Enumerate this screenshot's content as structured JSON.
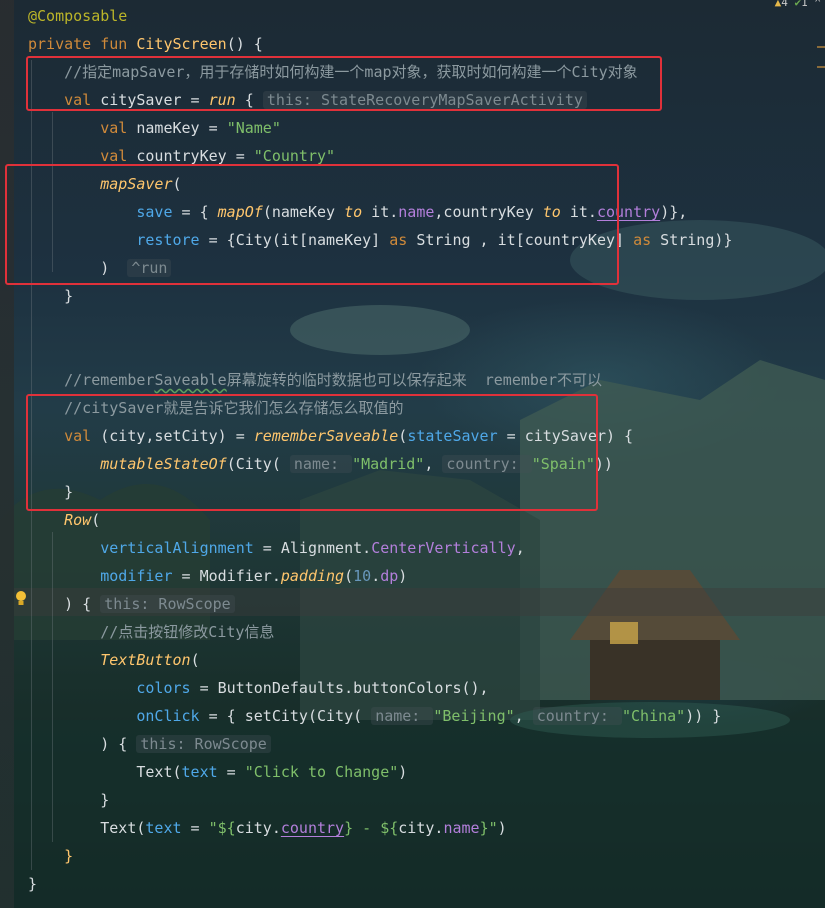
{
  "editor": {
    "top_status": {
      "warnings": "4",
      "weak_warnings": "1"
    },
    "lines": [
      {
        "id": "l1",
        "tokens": [
          {
            "t": "@Composable",
            "c": "ann"
          }
        ]
      },
      {
        "id": "l2",
        "tokens": [
          {
            "t": "private fun ",
            "c": "kw"
          },
          {
            "t": "CityScreen",
            "c": "fn"
          },
          {
            "t": "() {",
            "c": "txt"
          }
        ]
      },
      {
        "id": "l3",
        "tokens": [
          {
            "t": "    //指定mapSaver，用于存储时如何构建一个map对象，获取时如何构建一个City对象",
            "c": "cmt"
          }
        ]
      },
      {
        "id": "l4",
        "tokens": [
          {
            "t": "    val ",
            "c": "kw"
          },
          {
            "t": "citySaver",
            "c": "txt"
          },
          {
            "t": " = ",
            "c": "txt"
          },
          {
            "t": "run",
            "c": "fnit"
          },
          {
            "t": " { ",
            "c": "txt"
          },
          {
            "t": "this: StateRecoveryMapSaverActivity",
            "c": "hint"
          }
        ]
      },
      {
        "id": "l5",
        "tokens": [
          {
            "t": "        val ",
            "c": "kw"
          },
          {
            "t": "nameKey",
            "c": "txt"
          },
          {
            "t": " = ",
            "c": "txt"
          },
          {
            "t": "\"Name\"",
            "c": "str"
          }
        ]
      },
      {
        "id": "l6",
        "tokens": [
          {
            "t": "        val ",
            "c": "kw"
          },
          {
            "t": "countryKey",
            "c": "txt"
          },
          {
            "t": " = ",
            "c": "txt"
          },
          {
            "t": "\"Country\"",
            "c": "str"
          }
        ]
      },
      {
        "id": "l7",
        "tokens": [
          {
            "t": "        mapSaver",
            "c": "fnit"
          },
          {
            "t": "(",
            "c": "txt"
          }
        ]
      },
      {
        "id": "l8",
        "tokens": [
          {
            "t": "            save",
            "c": "prop"
          },
          {
            "t": " = { ",
            "c": "txt"
          },
          {
            "t": "mapOf",
            "c": "fnit"
          },
          {
            "t": "(nameKey ",
            "c": "txt"
          },
          {
            "t": "to",
            "c": "fnit"
          },
          {
            "t": " it.",
            "c": "txt"
          },
          {
            "t": "name",
            "c": "purp"
          },
          {
            "t": ",countryKey ",
            "c": "txt"
          },
          {
            "t": "to",
            "c": "fnit"
          },
          {
            "t": " it.",
            "c": "txt"
          },
          {
            "t": "country",
            "c": "purp",
            "u": "ul"
          },
          {
            "t": ")},",
            "c": "txt"
          }
        ]
      },
      {
        "id": "l9",
        "tokens": [
          {
            "t": "            restore",
            "c": "prop"
          },
          {
            "t": " = {City(",
            "c": "txt"
          },
          {
            "t": "it",
            "c": "txt"
          },
          {
            "t": "[nameKey] ",
            "c": "txt"
          },
          {
            "t": "as",
            "c": "kw"
          },
          {
            "t": " String ,",
            "c": "txt"
          },
          {
            "t": " it",
            "c": "txt"
          },
          {
            "t": "[countryKey] ",
            "c": "txt"
          },
          {
            "t": "as",
            "c": "kw"
          },
          {
            "t": " String)}",
            "c": "txt"
          }
        ]
      },
      {
        "id": "l10",
        "tokens": [
          {
            "t": "        )  ",
            "c": "txt"
          },
          {
            "t": "^run",
            "c": "hint"
          }
        ]
      },
      {
        "id": "l11",
        "tokens": [
          {
            "t": "    }",
            "c": "txt"
          }
        ]
      },
      {
        "id": "l12",
        "tokens": []
      },
      {
        "id": "l13",
        "tokens": []
      },
      {
        "id": "l14",
        "tokens": [
          {
            "t": "    //remember",
            "c": "cmt"
          },
          {
            "t": "Saveable",
            "c": "cmt",
            "u": "wavy"
          },
          {
            "t": "屏幕旋转的临时数据也可以保存起来  remember不可以",
            "c": "cmt"
          }
        ]
      },
      {
        "id": "l15",
        "tokens": [
          {
            "t": "    //citySaver就是告诉它我们怎么存储怎么取值的",
            "c": "cmt"
          }
        ]
      },
      {
        "id": "l16",
        "tokens": [
          {
            "t": "    val ",
            "c": "kw"
          },
          {
            "t": "(city,setCity) = ",
            "c": "txt"
          },
          {
            "t": "rememberSaveable",
            "c": "fnit"
          },
          {
            "t": "(",
            "c": "txt"
          },
          {
            "t": "stateSaver",
            "c": "prop"
          },
          {
            "t": " = citySaver) {",
            "c": "txt"
          }
        ]
      },
      {
        "id": "l17",
        "tokens": [
          {
            "t": "        mutableStateOf",
            "c": "fnit"
          },
          {
            "t": "(City( ",
            "c": "txt"
          },
          {
            "t": "name: ",
            "c": "hint"
          },
          {
            "t": "\"Madrid\"",
            "c": "str"
          },
          {
            "t": ", ",
            "c": "txt"
          },
          {
            "t": "country: ",
            "c": "hint"
          },
          {
            "t": "\"Spain\"",
            "c": "str"
          },
          {
            "t": "))",
            "c": "txt"
          }
        ]
      },
      {
        "id": "l18",
        "tokens": [
          {
            "t": "    }",
            "c": "txt"
          }
        ]
      },
      {
        "id": "l19",
        "tokens": [
          {
            "t": "    Row",
            "c": "fnit"
          },
          {
            "t": "(",
            "c": "txt"
          }
        ]
      },
      {
        "id": "l20",
        "tokens": [
          {
            "t": "        verticalAlignment",
            "c": "prop"
          },
          {
            "t": " = Alignment.",
            "c": "txt"
          },
          {
            "t": "CenterVertically",
            "c": "purp"
          },
          {
            "t": ",",
            "c": "txt"
          }
        ]
      },
      {
        "id": "l21",
        "tokens": [
          {
            "t": "        modifier",
            "c": "prop"
          },
          {
            "t": " = Modifier.",
            "c": "txt"
          },
          {
            "t": "padding",
            "c": "fnit"
          },
          {
            "t": "(",
            "c": "txt"
          },
          {
            "t": "10",
            "c": "num"
          },
          {
            "t": ".",
            "c": "txt"
          },
          {
            "t": "dp",
            "c": "purp"
          },
          {
            "t": ")",
            "c": "txt"
          }
        ]
      },
      {
        "id": "l22",
        "tokens": [
          {
            "t": "    ) { ",
            "c": "txt"
          },
          {
            "t": "this: RowScope",
            "c": "hint"
          }
        ]
      },
      {
        "id": "l23",
        "tokens": [
          {
            "t": "        //点击按钮修改City信息",
            "c": "cmt"
          }
        ]
      },
      {
        "id": "l24",
        "tokens": [
          {
            "t": "        TextButton",
            "c": "fnit"
          },
          {
            "t": "(",
            "c": "txt"
          }
        ]
      },
      {
        "id": "l25",
        "tokens": [
          {
            "t": "            colors",
            "c": "prop"
          },
          {
            "t": " = ButtonDefaults.buttonColors(),",
            "c": "txt"
          }
        ]
      },
      {
        "id": "l26",
        "tokens": [
          {
            "t": "            onClick",
            "c": "prop"
          },
          {
            "t": " = { setCity(City( ",
            "c": "txt"
          },
          {
            "t": "name: ",
            "c": "hint"
          },
          {
            "t": "\"Beijing\"",
            "c": "str"
          },
          {
            "t": ", ",
            "c": "txt"
          },
          {
            "t": "country: ",
            "c": "hint"
          },
          {
            "t": "\"China\"",
            "c": "str"
          },
          {
            "t": ")) }",
            "c": "txt"
          }
        ]
      },
      {
        "id": "l27",
        "tokens": [
          {
            "t": "        ) { ",
            "c": "txt"
          },
          {
            "t": "this: RowScope",
            "c": "hint"
          }
        ]
      },
      {
        "id": "l28",
        "tokens": [
          {
            "t": "            Text",
            "c": "txt"
          },
          {
            "t": "(",
            "c": "txt"
          },
          {
            "t": "text",
            "c": "prop"
          },
          {
            "t": " = ",
            "c": "txt"
          },
          {
            "t": "\"Click to Change\"",
            "c": "str"
          },
          {
            "t": ")",
            "c": "txt"
          }
        ]
      },
      {
        "id": "l29",
        "tokens": [
          {
            "t": "        }",
            "c": "txt"
          }
        ]
      },
      {
        "id": "l30",
        "tokens": [
          {
            "t": "        Text",
            "c": "txt"
          },
          {
            "t": "(",
            "c": "txt"
          },
          {
            "t": "text",
            "c": "prop"
          },
          {
            "t": " = ",
            "c": "txt"
          },
          {
            "t": "\"${",
            "c": "str"
          },
          {
            "t": "city.",
            "c": "txt"
          },
          {
            "t": "country",
            "c": "purp",
            "u": "ul"
          },
          {
            "t": "}",
            "c": "str"
          },
          {
            "t": " - ",
            "c": "str"
          },
          {
            "t": "${",
            "c": "str"
          },
          {
            "t": "city.",
            "c": "txt"
          },
          {
            "t": "name",
            "c": "purp"
          },
          {
            "t": "}\"",
            "c": "str"
          },
          {
            "t": ")",
            "c": "txt"
          }
        ]
      },
      {
        "id": "l31",
        "tokens": [
          {
            "t": "    }",
            "c": "fn"
          }
        ]
      },
      {
        "id": "l32",
        "tokens": [
          {
            "t": "}",
            "c": "txt"
          }
        ]
      }
    ]
  }
}
